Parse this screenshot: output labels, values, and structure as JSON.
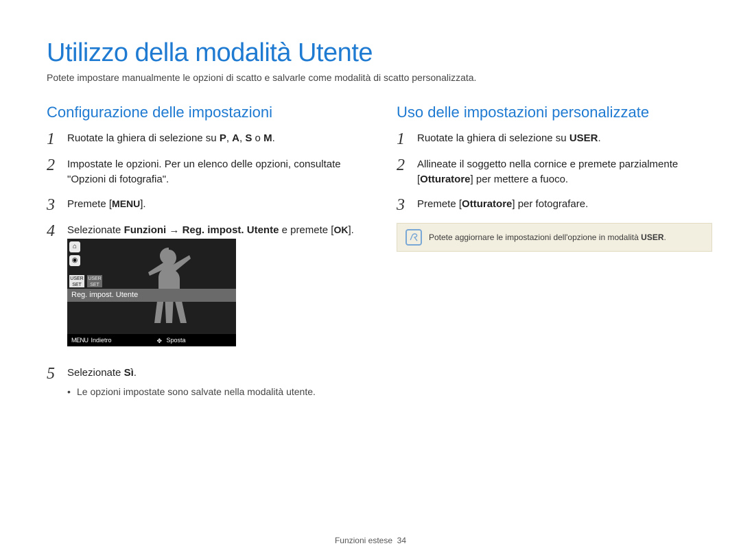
{
  "title": "Utilizzo della modalità Utente",
  "intro": "Potete impostare manualmente le opzioni di scatto e salvarle come modalità di scatto personalizzata.",
  "left": {
    "heading": "Configurazione delle impostazioni",
    "step1_pre": "Ruotate la ghiera di selezione su ",
    "step1_modes": {
      "p": "P",
      "a": "A",
      "s": "S",
      "m": "M"
    },
    "step1_or": " o ",
    "step2": "Impostate le opzioni. Per un elenco delle opzioni, consultate \"Opzioni di fotografia\".",
    "step3_pre": "Premete [",
    "step3_menu": "MENU",
    "step3_post": "].",
    "step4_pre": "Selezionate ",
    "step4_bold1": "Funzioni",
    "step4_arrow": " → ",
    "step4_bold2": "Reg. impost. Utente",
    "step4_mid": " e premete [",
    "step4_ok": "OK",
    "step4_post": "].",
    "lcd": {
      "selected_row": "Reg. impost. Utente",
      "back_menu": "MENU",
      "back_label": "Indietro",
      "move_label": "Sposta",
      "tab1": "USER\nSET",
      "tab2": "USER\nSET"
    },
    "step5_pre": "Selezionate ",
    "step5_bold": "Sì",
    "step5_post": ".",
    "step5_bullet": "Le opzioni impostate sono salvate nella modalità utente."
  },
  "right": {
    "heading": "Uso delle impostazioni personalizzate",
    "step1_pre": "Ruotate la ghiera di selezione su ",
    "step1_user": "USER",
    "step1_post": ".",
    "step2_pre": "Allineate il soggetto nella cornice e premete parzialmente [",
    "step2_bold": "Otturatore",
    "step2_post": "] per mettere a fuoco.",
    "step3_pre": "Premete [",
    "step3_bold": "Otturatore",
    "step3_post": "] per fotografare.",
    "note_pre": "Potete aggiornare le impostazioni dell'opzione in modalità ",
    "note_user": "USER",
    "note_post": "."
  },
  "footer": {
    "section": "Funzioni estese",
    "page": "34"
  }
}
